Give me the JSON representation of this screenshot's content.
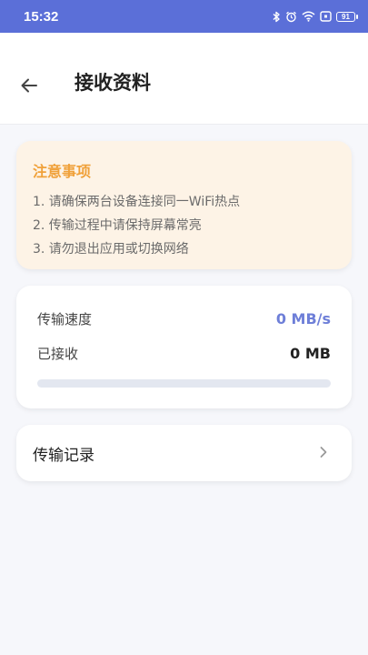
{
  "status_bar": {
    "time": "15:32",
    "battery": "91",
    "icons": [
      "bluetooth-icon",
      "alarm-icon",
      "wifi-icon",
      "nfc-icon",
      "battery-icon"
    ]
  },
  "header": {
    "title": "接收资料",
    "back_icon": "arrow-left-icon"
  },
  "notice": {
    "title": "注意事项",
    "items": [
      "1. 请确保两台设备连接同一WiFi热点",
      "2. 传输过程中请保持屏幕常亮",
      "3. 请勿退出应用或切换网络"
    ]
  },
  "transfer": {
    "speed_label": "传输速度",
    "speed_value": "0 MB/s",
    "received_label": "已接收",
    "received_value": "0 MB",
    "progress": 0
  },
  "record": {
    "label": "传输记录",
    "chevron_icon": "chevron-right-icon"
  },
  "colors": {
    "status_bar": "#5b6fd8",
    "accent": "#6e7fd8",
    "notice_title": "#f0a13a",
    "notice_bg": "#fdf3e6",
    "page_bg": "#f6f7fb"
  }
}
